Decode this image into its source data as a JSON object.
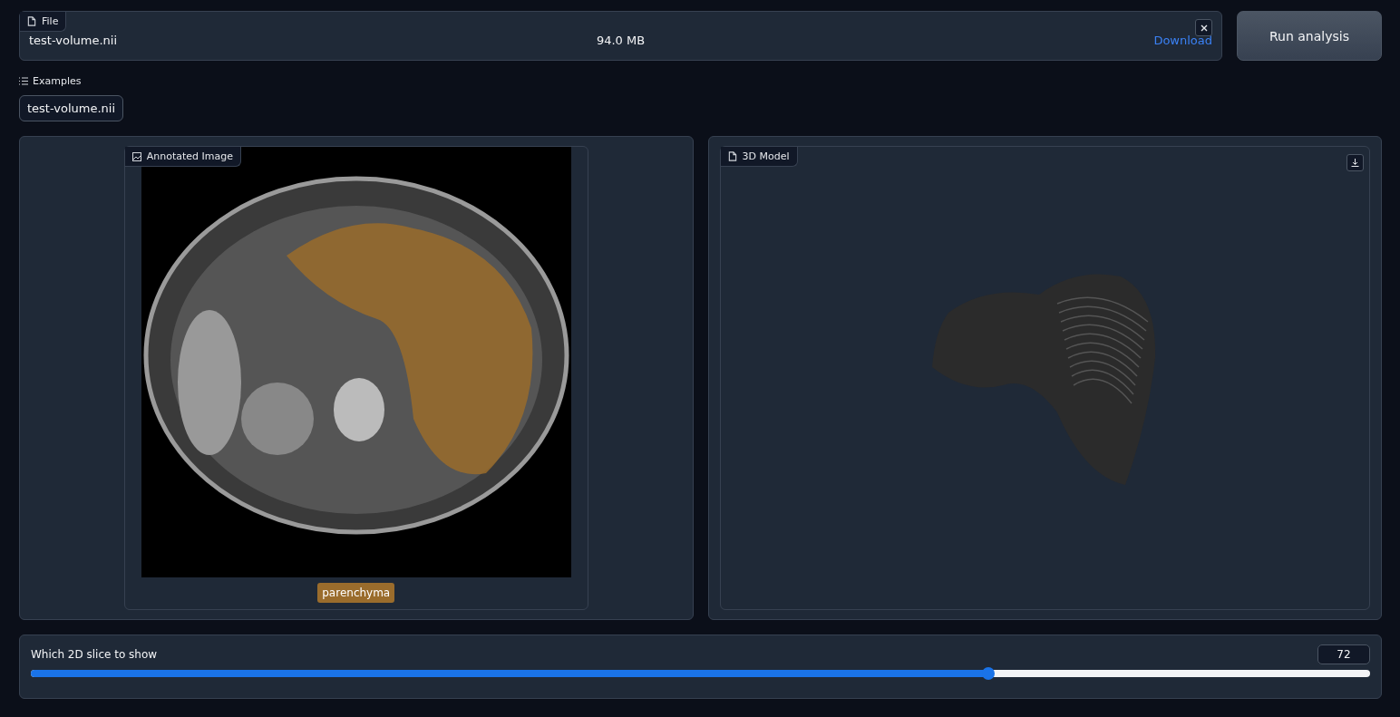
{
  "file_input": {
    "label": "File",
    "file_name": "test-volume.nii",
    "file_size": "94.0 MB",
    "download": "Download"
  },
  "run_button": "Run analysis",
  "examples": {
    "label": "Examples",
    "items": [
      "test-volume.nii"
    ]
  },
  "annotated_image": {
    "label": "Annotated Image",
    "annotations": [
      {
        "label": "parenchyma",
        "color": "#9a6c2c"
      }
    ]
  },
  "model_3d": {
    "label": "3D Model"
  },
  "slider": {
    "label": "Which 2D slice to show",
    "value": "72",
    "level": 0.715
  }
}
